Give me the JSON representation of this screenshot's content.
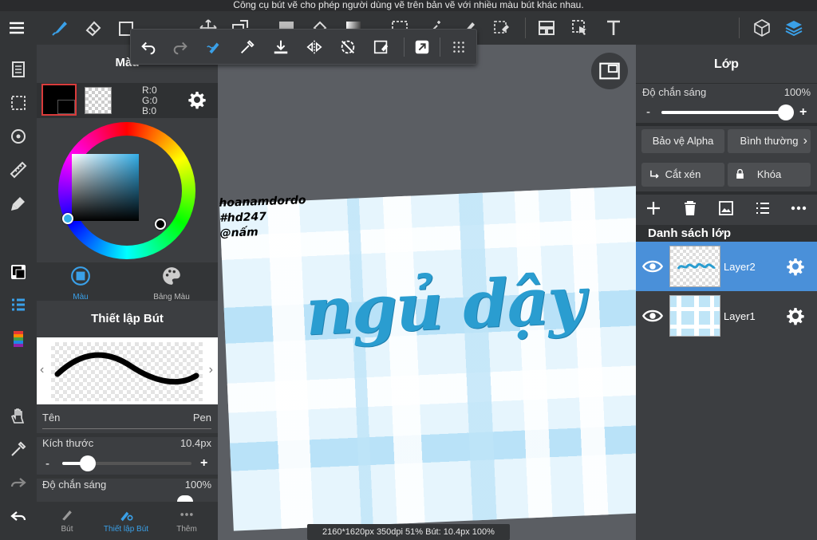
{
  "tooltip": "Công cụ bút vẽ cho phép người dùng vẽ trên bản vẽ với nhiều màu bút khác nhau.",
  "color_panel": {
    "title": "Màu",
    "r": "R:0",
    "g": "G:0",
    "b": "B:0",
    "tabs": [
      "Màu",
      "Bảng Màu"
    ]
  },
  "brush_panel": {
    "title": "Thiết lập Bút",
    "name_label": "Tên",
    "name_value": "Pen",
    "size_label": "Kích thước",
    "size_value": "10.4px",
    "size_fraction": 0.2,
    "opacity_label": "Độ chắn sáng",
    "opacity_value": "100%",
    "tabs": [
      "Bút",
      "Thiết lập Bút",
      "Thêm"
    ]
  },
  "canvas": {
    "watermark": [
      "hoanamdordo",
      "#hd247",
      "@nấm"
    ],
    "lettering": "ngủ dậy",
    "status": "2160*1620px 350dpi 51% Bút: 10.4px 100%"
  },
  "layer_panel": {
    "title": "Lớp",
    "opacity_label": "Độ chắn sáng",
    "opacity_value": "100%",
    "alpha_protect": "Bảo vệ Alpha",
    "blend_mode": "Bình thường",
    "clip": "Cắt xén",
    "lock": "Khóa",
    "list_label": "Danh sách lớp",
    "layers": [
      {
        "name": "Layer2",
        "selected": true
      },
      {
        "name": "Layer1",
        "selected": false
      }
    ]
  },
  "colors": {
    "accent": "#4a90d9",
    "active_icon": "#3aa0e8",
    "ink": "#2a9dd0"
  }
}
